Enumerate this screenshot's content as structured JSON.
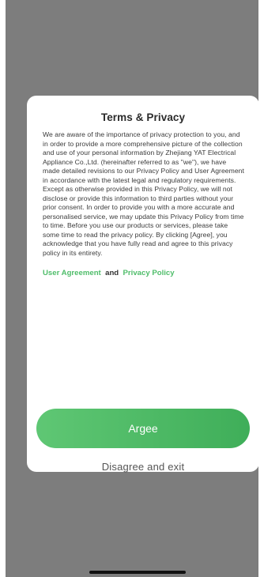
{
  "dialog": {
    "title": "Terms & Privacy",
    "body": "We are aware of the importance of privacy protection to you, and in order to provide a more comprehensive picture of the collection and use of your personal information by Zhejiang YAT Electrical Appliance Co.,Ltd. (hereinafter referred to as \"we\"), we have made detailed revisions to our Privacy Policy and User Agreement in accordance with the latest legal and regulatory requirements. Except as otherwise provided in this Privacy Policy, we will not disclose or provide this information to third parties without your prior consent. In order to provide you with a more accurate and personalised service, we may update this Privacy Policy from time to time. Before you use our products or services, please take some time to read the privacy policy. By clicking [Agree], you acknowledge that you have fully read and agree to this privacy policy in its entirety.",
    "links": {
      "user_agreement": "User Agreement",
      "conjunction": "and",
      "privacy_policy": "Privacy Policy"
    },
    "agree_label": "Argee",
    "disagree_label": "Disagree and exit"
  },
  "colors": {
    "accent": "#4fbd6a",
    "overlay": "#7d7d7d",
    "button_gradient_start": "#5fc774",
    "button_gradient_end": "#3fae59"
  }
}
